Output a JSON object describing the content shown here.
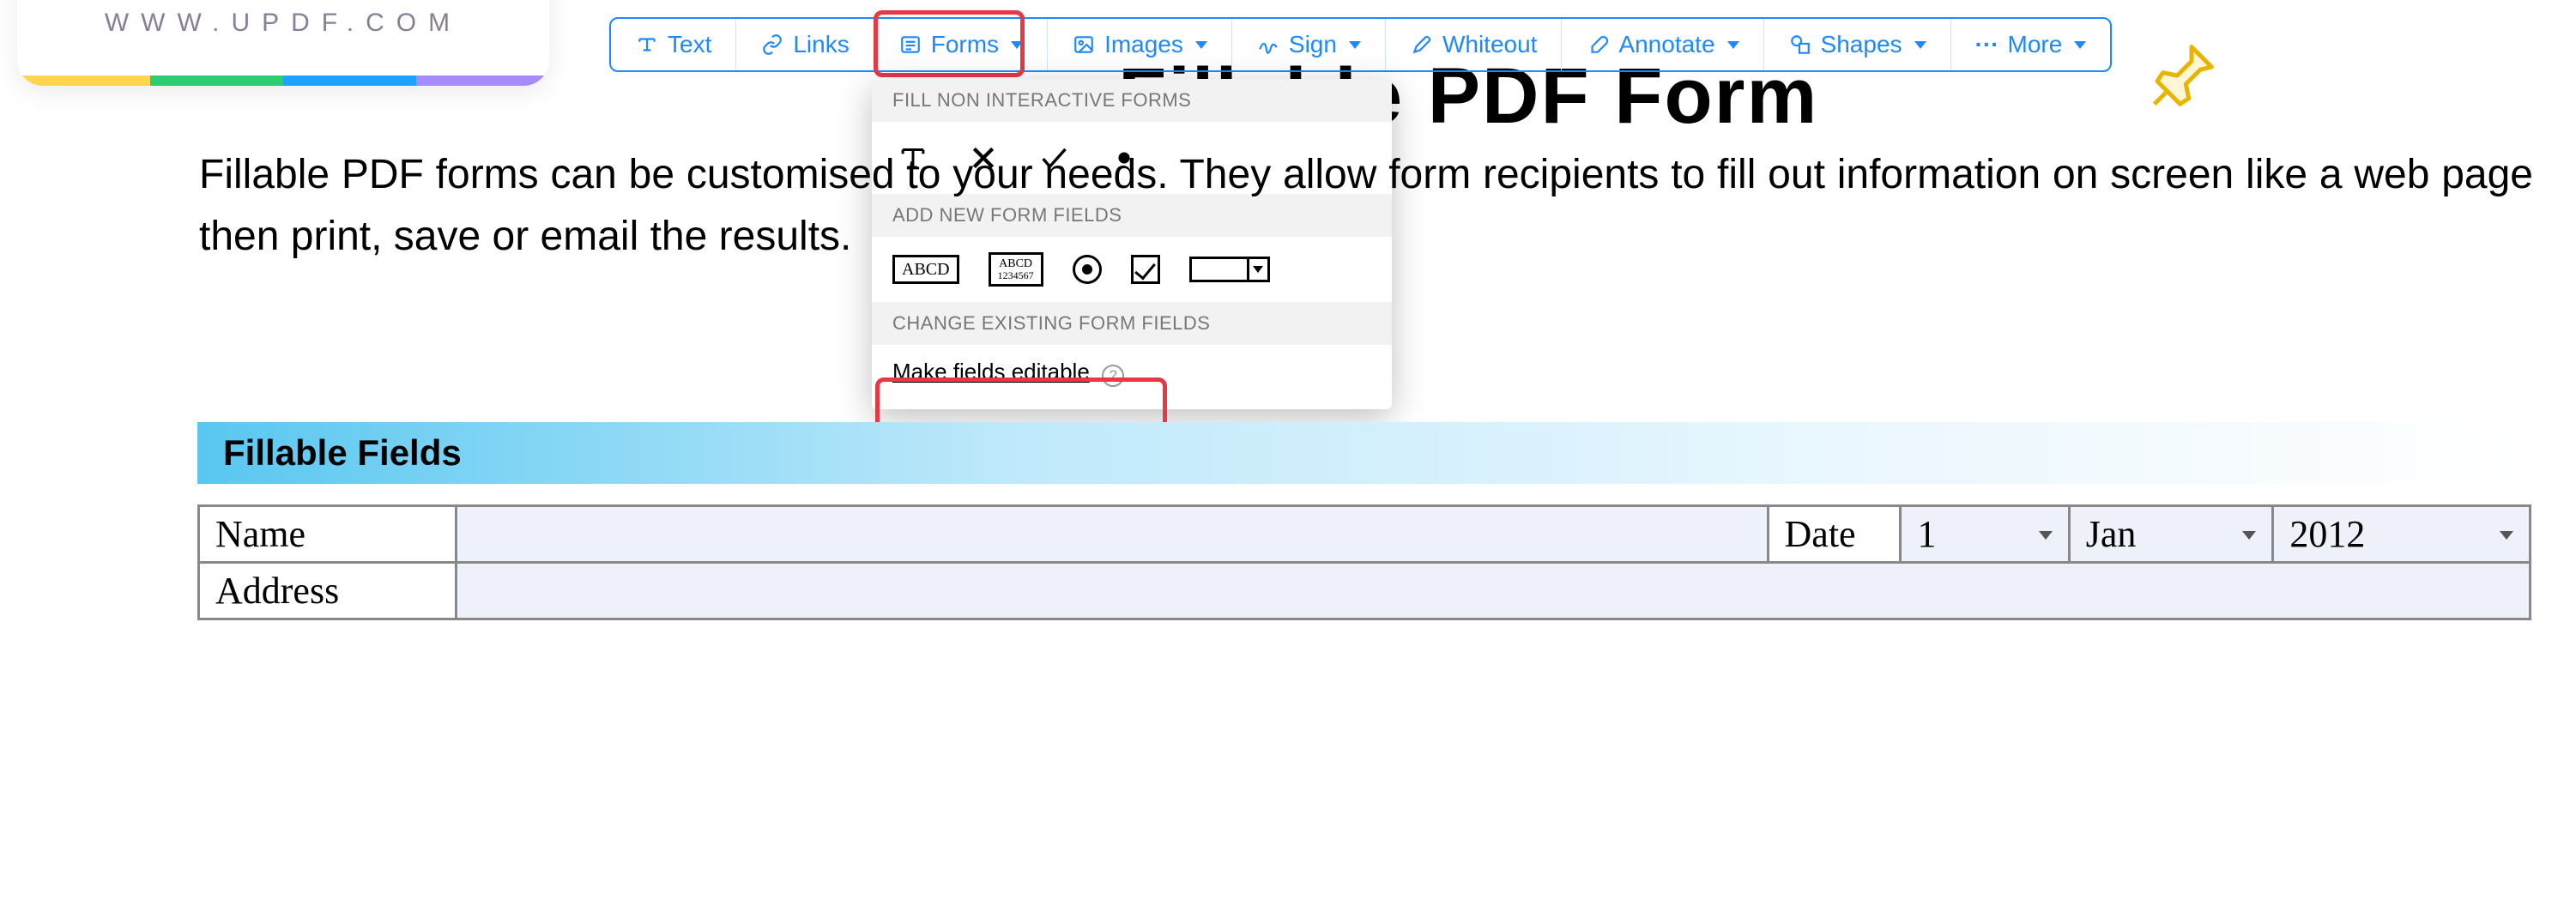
{
  "logo": {
    "url_text": "WWW.UPDF.COM"
  },
  "toolbar": {
    "text": "Text",
    "links": "Links",
    "forms": "Forms",
    "images": "Images",
    "sign": "Sign",
    "whiteout": "Whiteout",
    "annotate": "Annotate",
    "shapes": "Shapes",
    "more": "More"
  },
  "dropdown": {
    "section_fill": "FILL NON INTERACTIVE FORMS",
    "section_add": "ADD NEW FORM FIELDS",
    "section_change": "CHANGE EXISTING FORM FIELDS",
    "field_text_label": "ABCD",
    "field_multiline_label": "ABCD",
    "field_multiline_sub": "1234567",
    "make_editable": "Make fields editable",
    "help": "?"
  },
  "document": {
    "body_text": "Fillable PDF forms can be customised to your needs. They allow form recipients to fill out information on screen like a web page then print, save or email the results.",
    "section_title": "Fillable Fields",
    "labels": {
      "name": "Name",
      "address": "Address",
      "date": "Date"
    },
    "date": {
      "day": "1",
      "month": "Jan",
      "year": "2012"
    }
  }
}
